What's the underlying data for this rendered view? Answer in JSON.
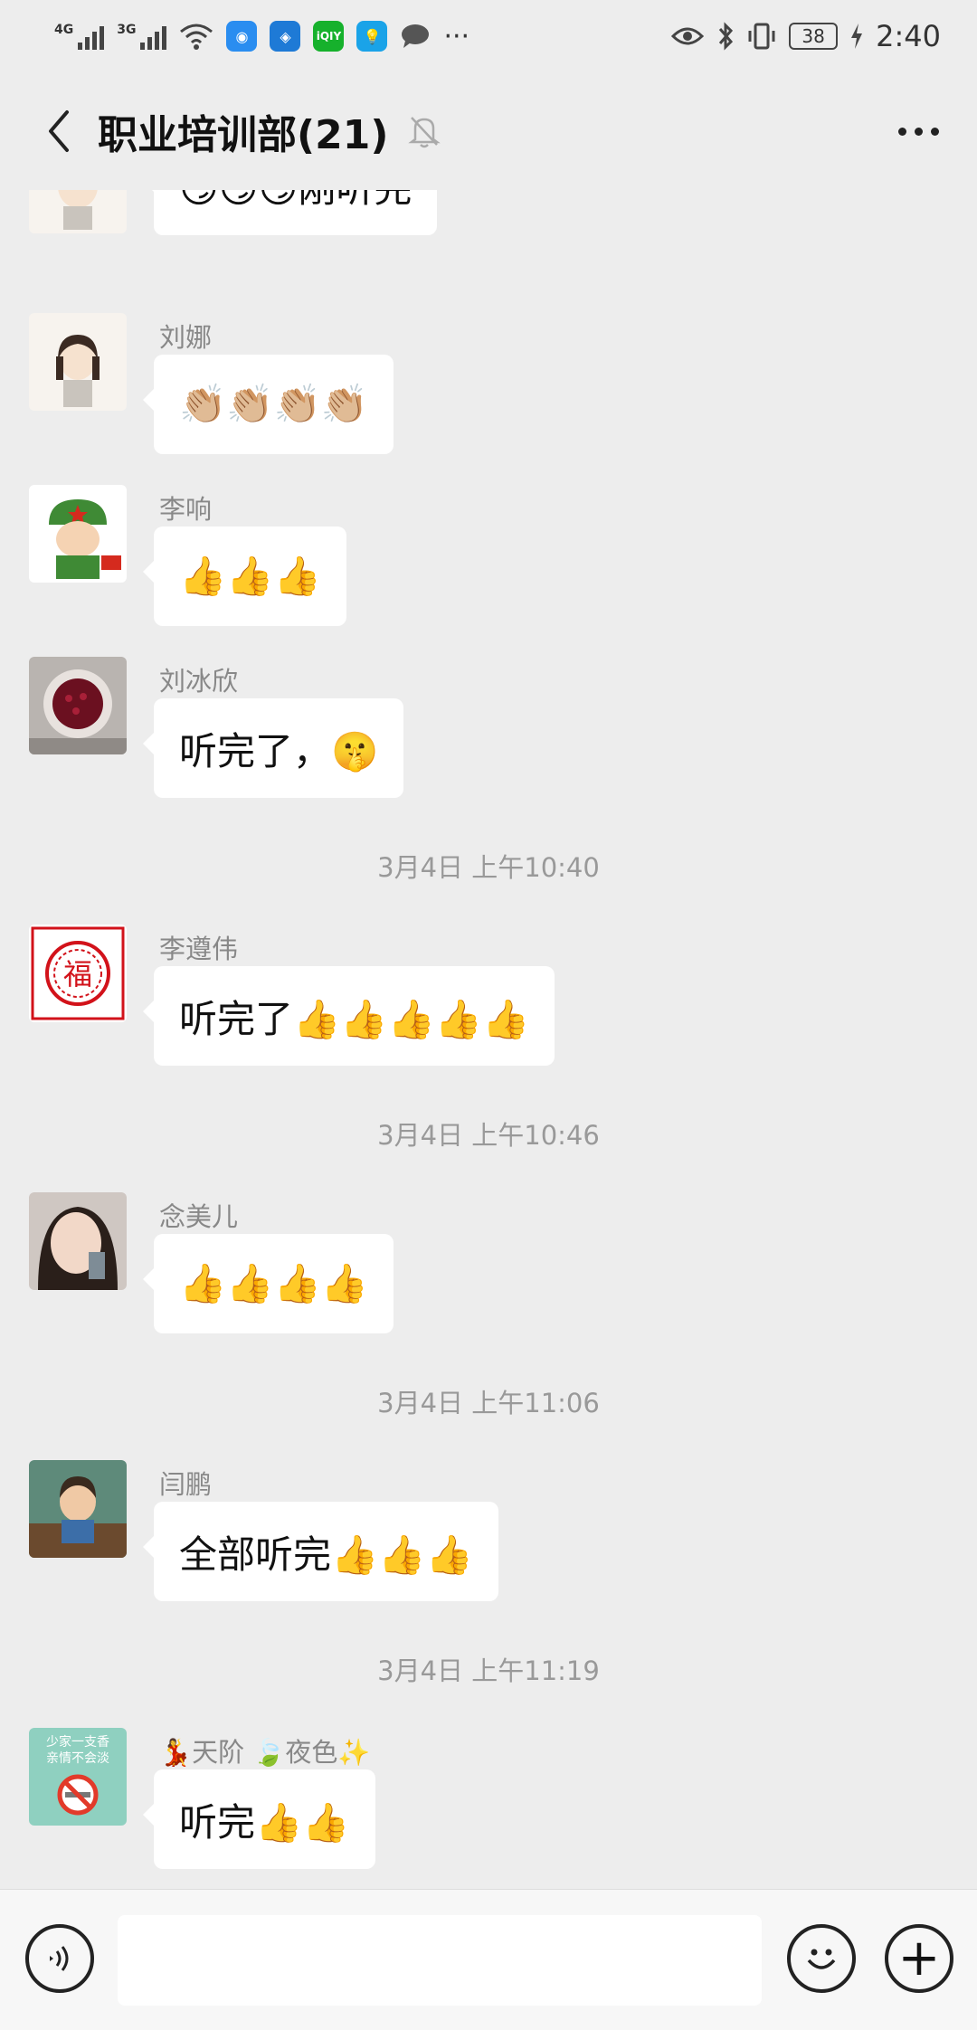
{
  "status_bar": {
    "net1": "4G",
    "net2": "3G",
    "battery": "38",
    "time": "2:40",
    "app_icons": [
      "browser-icon",
      "app-icon",
      "iqiyi-icon",
      "lightbulb-icon",
      "chat-icon"
    ],
    "iqiyi_label": "iQIY",
    "more_label": "···"
  },
  "header": {
    "title": "职业培训部(21)",
    "icons": [
      "back-arrow-icon",
      "mute-bell-icon",
      "more-dots-icon"
    ]
  },
  "messages": [
    {
      "sender": "",
      "text": "😏😏😏刚听完"
    },
    {
      "sender": "刘娜",
      "text": "👏🏼👏🏼👏🏼👏🏼"
    },
    {
      "sender": "李响",
      "text": "👍👍👍"
    },
    {
      "sender": "刘冰欣",
      "text": "听完了，🤫"
    },
    {
      "sender": "李遵伟",
      "text": "听完了👍👍👍👍👍"
    },
    {
      "sender": "念美儿",
      "text": "👍👍👍👍"
    },
    {
      "sender": "闫鹏",
      "text": "全部听完👍👍👍"
    },
    {
      "sender": "💃天阶 🍃夜色✨",
      "text": "听完👍👍"
    }
  ],
  "timestamps": [
    "3月4日 上午10:40",
    "3月4日 上午10:46",
    "3月4日 上午11:06",
    "3月4日 上午11:19"
  ],
  "avatar_texts": {
    "fu": "福",
    "poster_line1": "少家一支香",
    "poster_line2": "亲情不会淡"
  },
  "input_bar": {
    "icons": [
      "voice-icon",
      "emoji-icon",
      "plus-icon"
    ],
    "plus_label": "+"
  },
  "colors": {
    "background": "#ededed",
    "bubble": "#ffffff",
    "sender_text": "#888888",
    "timestamp_text": "#999999"
  }
}
